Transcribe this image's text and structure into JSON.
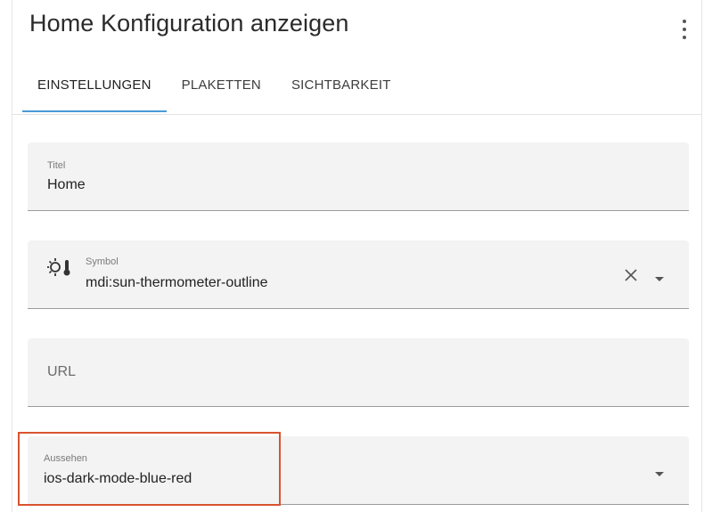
{
  "dialog": {
    "title": "Home Konfiguration anzeigen"
  },
  "tabs": [
    {
      "label": "EINSTELLUNGEN",
      "active": true
    },
    {
      "label": "PLAKETTEN",
      "active": false
    },
    {
      "label": "SICHTBARKEIT",
      "active": false
    }
  ],
  "fields": {
    "title": {
      "label": "Titel",
      "value": "Home"
    },
    "symbol": {
      "label": "Symbol",
      "value": "mdi:sun-thermometer-outline",
      "icon": "sun-thermometer-icon"
    },
    "url": {
      "placeholder": "URL",
      "value": ""
    },
    "appearance": {
      "label": "Aussehen",
      "value": "ios-dark-mode-blue-red"
    }
  },
  "colors": {
    "accent": "#4a9bd6",
    "highlight": "#d9532f",
    "field_background": "#f3f3f3"
  }
}
